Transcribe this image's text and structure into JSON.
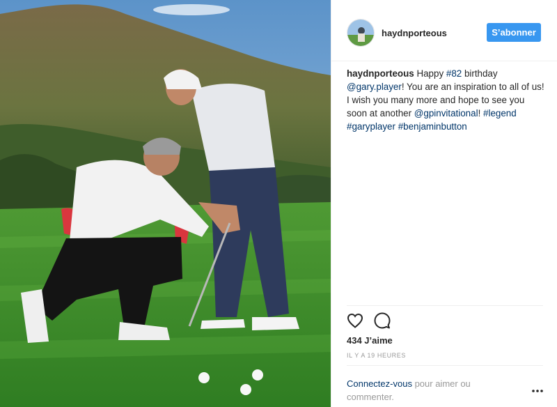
{
  "post": {
    "photo_alt": "golf-lesson-photo",
    "author": "haydnporteous",
    "follow_label": "S’abonner",
    "caption": {
      "user": "haydnporteous",
      "t1": " Happy ",
      "tag_82": "#82",
      "t2": " birthday ",
      "mention_gary": "@gary.player",
      "t3": "! You are an inspiration to all of us! I wish you many more and hope to see you soon at another ",
      "mention_gp": "@gpinvitational",
      "t4": "! ",
      "tag_legend": "#legend",
      "t5": " ",
      "tag_garyplayer": "#garyplayer",
      "t6": " ",
      "tag_benjamin": "#benjaminbutton"
    },
    "likes": "434 J’aime",
    "time_ago": "IL Y A 19 HEURES",
    "login_link": "Connectez-vous",
    "login_rest": " pour aimer ou commenter."
  },
  "icons": {
    "heart": "heart-icon",
    "comment": "comment-icon",
    "more": "more-options-icon"
  },
  "colors": {
    "accent": "#3897f0",
    "link": "#003569",
    "muted": "#999999"
  }
}
